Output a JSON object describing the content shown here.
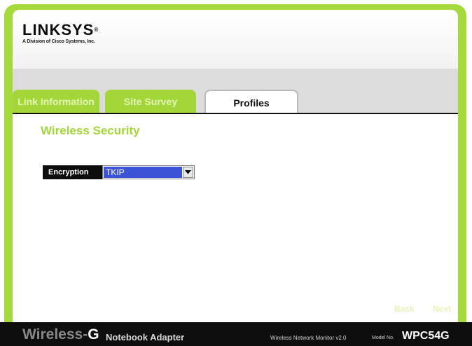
{
  "logo": {
    "name": "LINKSYS",
    "registered": "®",
    "subtitle": "A Division of Cisco Systems, Inc."
  },
  "tabs": [
    {
      "label": "Link Information",
      "active": false
    },
    {
      "label": "Site Survey",
      "active": false
    },
    {
      "label": "Profiles",
      "active": true
    }
  ],
  "section": {
    "title": "Wireless Security"
  },
  "encryption": {
    "label": "Encryption",
    "selected": "TKIP"
  },
  "nav": {
    "back": "Back",
    "next": "Next"
  },
  "footer": {
    "product_part1": "Wireless-",
    "product_part2": "G",
    "product_sub": "Notebook Adapter",
    "monitor": "Wireless Network Monitor v2.0",
    "model_label": "Model No.",
    "model": "WPC54G"
  },
  "colors": {
    "accent_green": "#a3d638",
    "bar_black": "#0e0e0e",
    "select_highlight": "#3b53d6"
  }
}
